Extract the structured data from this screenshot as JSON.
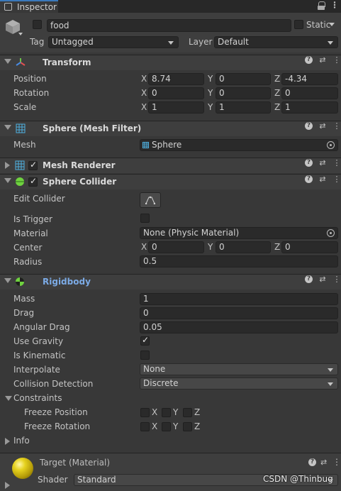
{
  "tab": {
    "title": "Inspector"
  },
  "object": {
    "name": "food",
    "static_label": "Static",
    "tag_label": "Tag",
    "tag_value": "Untagged",
    "layer_label": "Layer",
    "layer_value": "Default"
  },
  "transform": {
    "title": "Transform",
    "position": {
      "label": "Position",
      "x": "8.74",
      "y": "0",
      "z": "-4.34"
    },
    "rotation": {
      "label": "Rotation",
      "x": "0",
      "y": "0",
      "z": "0"
    },
    "scale": {
      "label": "Scale",
      "x": "1",
      "y": "1",
      "z": "1"
    },
    "axes": {
      "x": "X",
      "y": "Y",
      "z": "Z"
    }
  },
  "mesh_filter": {
    "title": "Sphere (Mesh Filter)",
    "mesh_label": "Mesh",
    "mesh_value": "Sphere"
  },
  "mesh_renderer": {
    "title": "Mesh Renderer"
  },
  "sphere_collider": {
    "title": "Sphere Collider",
    "edit_collider_label": "Edit Collider",
    "is_trigger_label": "Is Trigger",
    "material_label": "Material",
    "material_value": "None (Physic Material)",
    "center_label": "Center",
    "center": {
      "x": "0",
      "y": "0",
      "z": "0"
    },
    "radius_label": "Radius",
    "radius_value": "0.5"
  },
  "rigidbody": {
    "title": "Rigidbody",
    "mass_label": "Mass",
    "mass_value": "1",
    "drag_label": "Drag",
    "drag_value": "0",
    "angular_drag_label": "Angular Drag",
    "angular_drag_value": "0.05",
    "use_gravity_label": "Use Gravity",
    "is_kinematic_label": "Is Kinematic",
    "interpolate_label": "Interpolate",
    "interpolate_value": "None",
    "collision_label": "Collision Detection",
    "collision_value": "Discrete",
    "constraints_label": "Constraints",
    "freeze_position_label": "Freeze Position",
    "freeze_rotation_label": "Freeze Rotation",
    "info_label": "Info"
  },
  "material": {
    "title": "Target (Material)",
    "shader_label": "Shader",
    "shader_value": "Standard"
  },
  "watermark": "CSDN @Thinbug",
  "colors": {
    "background": "#383838",
    "header": "#3e3e3e",
    "field": "#2a2a2a",
    "rigidbody_title": "#7cabe6",
    "collider_icon": "#6fd23f",
    "material_sphere": "#d8c21a"
  },
  "icons": {
    "gameobject": "cube-icon",
    "transform": "axes-icon",
    "mesh_filter": "grid-icon",
    "collider": "sphere-icon",
    "rigidbody": "rigidbody-icon",
    "help": "question-icon",
    "preset": "sliders-icon",
    "menu": "kebab-icon",
    "edit_collider": "edit-bounds-icon"
  }
}
